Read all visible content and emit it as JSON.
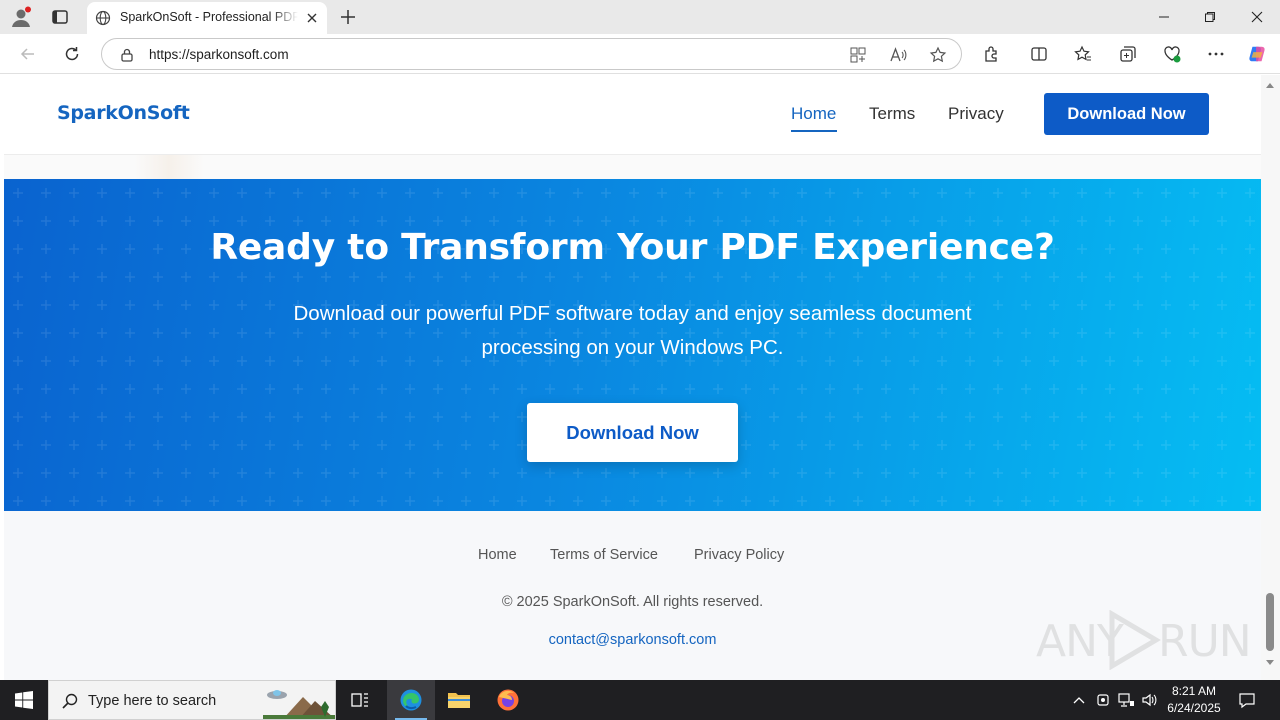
{
  "browser": {
    "tab_title": "SparkOnSoft - Professional PDF Software",
    "url": "https://sparkonsoft.com"
  },
  "site": {
    "logo": "SparkOnSoft",
    "nav": [
      {
        "label": "Home",
        "active": true
      },
      {
        "label": "Terms",
        "active": false
      },
      {
        "label": "Privacy",
        "active": false
      }
    ],
    "header_button": "Download Now"
  },
  "cta": {
    "title": "Ready to Transform Your PDF Experience?",
    "text": "Download our powerful PDF software today and enjoy seamless document processing on your Windows PC.",
    "button": "Download Now",
    "gradient_colors": [
      "#0a63cf",
      "#05bdf3"
    ]
  },
  "footer": {
    "links": [
      "Home",
      "Terms of Service",
      "Privacy Policy"
    ],
    "copyright": "© 2025 SparkOnSoft. All rights reserved.",
    "email": "contact@sparkonsoft.com"
  },
  "watermark": {
    "left": "ANY",
    "right": "RUN"
  },
  "taskbar": {
    "search_placeholder": "Type here to search",
    "time": "8:21 AM",
    "date": "6/24/2025",
    "apps": [
      "task-view-icon",
      "edge-icon",
      "file-explorer-icon",
      "firefox-icon"
    ]
  },
  "colors": {
    "brand": "#1565c0",
    "button": "#0d5bc7"
  }
}
